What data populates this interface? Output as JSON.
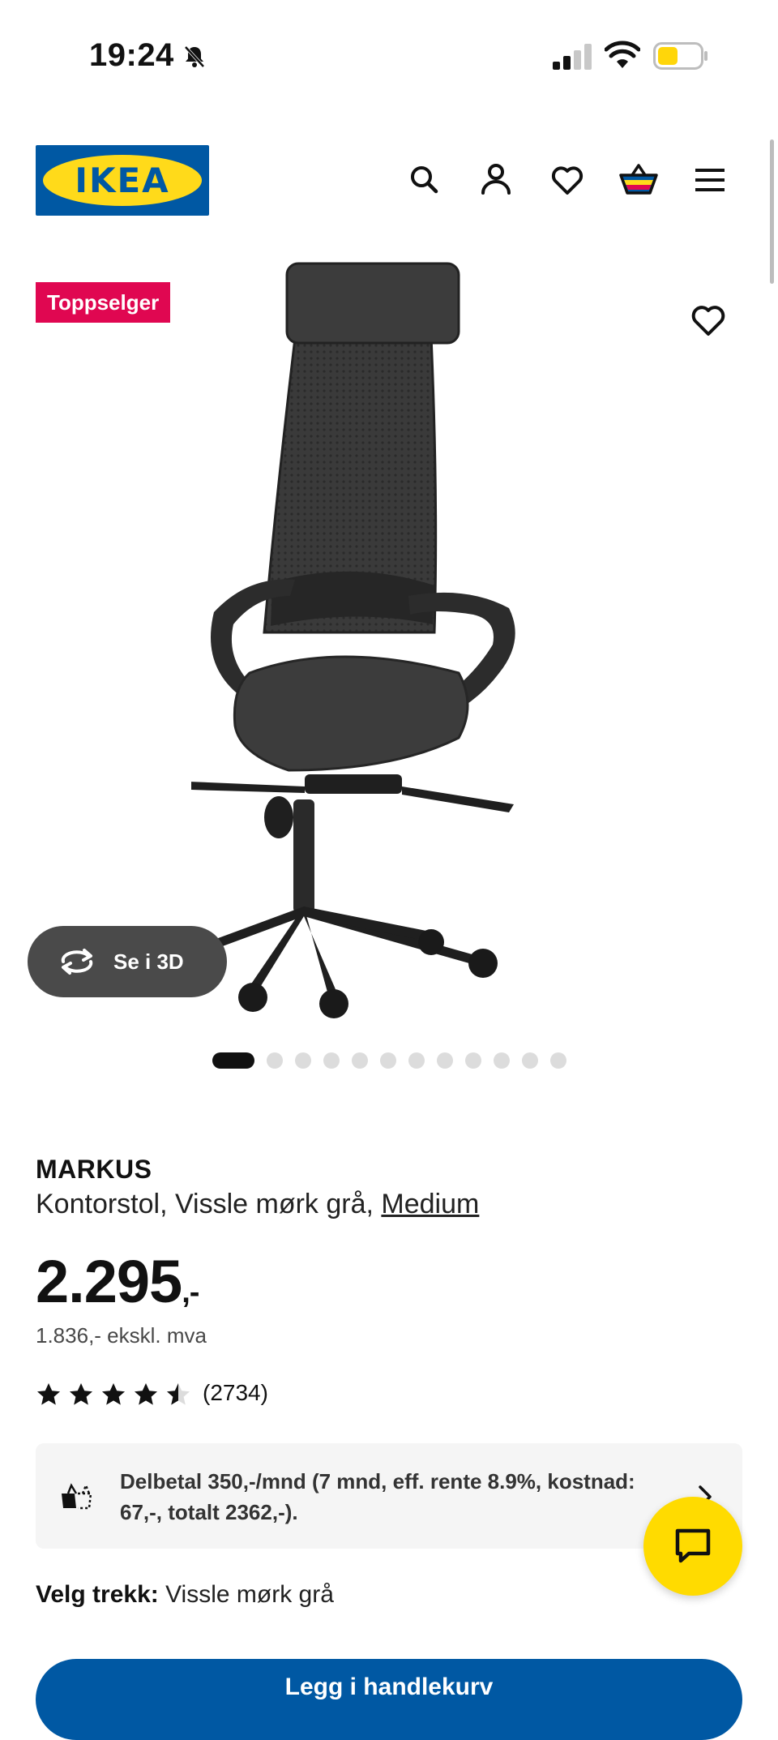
{
  "status_bar": {
    "time": "19:24",
    "icons": [
      "bell-slash-icon",
      "cellular-signal-icon",
      "wifi-icon",
      "battery-icon"
    ]
  },
  "header": {
    "logo_text": "IKEA",
    "icons": [
      "search-icon",
      "profile-icon",
      "favorites-heart-icon",
      "shopping-bag-icon",
      "hamburger-menu-icon"
    ]
  },
  "hero": {
    "badge": "Toppselger",
    "view_3d_label": "Se i 3D",
    "carousel": {
      "total": 12,
      "active_index": 0
    }
  },
  "product": {
    "name": "MARKUS",
    "description": "Kontorstol, Vissle mørk grå, ",
    "size_variant": "Medium",
    "price_main": "2.295",
    "price_suffix": ",-",
    "price_excl_vat": "1.836,- ekskl. mva",
    "rating": 4.5,
    "rating_max": 5,
    "review_count": "(2734)"
  },
  "payment": {
    "text": "Delbetal 350,-/mnd (7 mnd, eff. rente 8.9%, kostnad: 67,-, totalt 2362,-)."
  },
  "cover": {
    "label": "Velg trekk:",
    "value": "Vissle mørk grå"
  },
  "cta": {
    "label": "Legg i handlekurv"
  },
  "colors": {
    "ikea_blue": "#0058a3",
    "ikea_yellow": "#ffda1a",
    "badge_red": "#e00751",
    "chat_yellow": "#ffdb00"
  }
}
